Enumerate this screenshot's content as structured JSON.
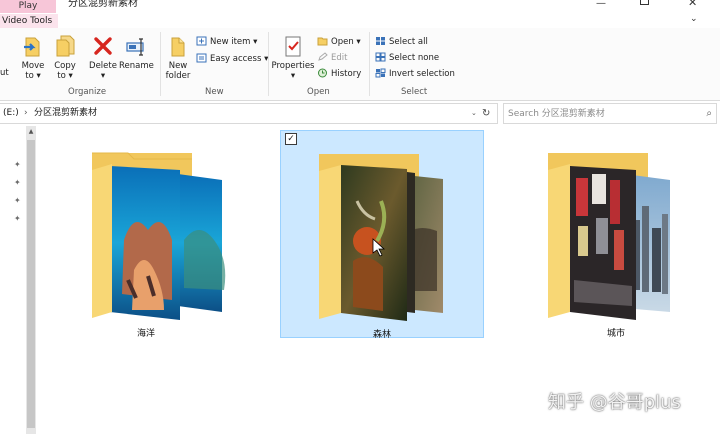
{
  "title_strip": {
    "contextual_tab": "Play",
    "contextual_group": "Video Tools",
    "window_title": "分区混剪新素材"
  },
  "ribbon": {
    "organize": {
      "cut_partial": "ut",
      "move_to_l1": "Move",
      "move_to_l2": "to",
      "copy_to_l1": "Copy",
      "copy_to_l2": "to",
      "delete": "Delete",
      "rename": "Rename",
      "label": "Organize"
    },
    "new": {
      "new_folder_l1": "New",
      "new_folder_l2": "folder",
      "new_item": "New item",
      "easy_access": "Easy access",
      "label": "New"
    },
    "open": {
      "properties": "Properties",
      "open": "Open",
      "edit": "Edit",
      "history": "History",
      "label": "Open"
    },
    "select": {
      "select_all": "Select all",
      "select_none": "Select none",
      "invert_selection": "Invert selection",
      "label": "Select"
    }
  },
  "address": {
    "drive": "(E:)",
    "path": "分区混剪新素材",
    "search_placeholder": "Search 分区混剪新素材"
  },
  "folders": [
    {
      "name": "海洋",
      "selected": false
    },
    {
      "name": "森林",
      "selected": true
    },
    {
      "name": "城市",
      "selected": false
    }
  ],
  "watermark": "知乎 @谷哥plus",
  "colors": {
    "selection_fill": "#cce8ff",
    "selection_border": "#99d1ff",
    "folder_yellow": "#f8d775",
    "contextual_tab": "#f7c6d8"
  }
}
